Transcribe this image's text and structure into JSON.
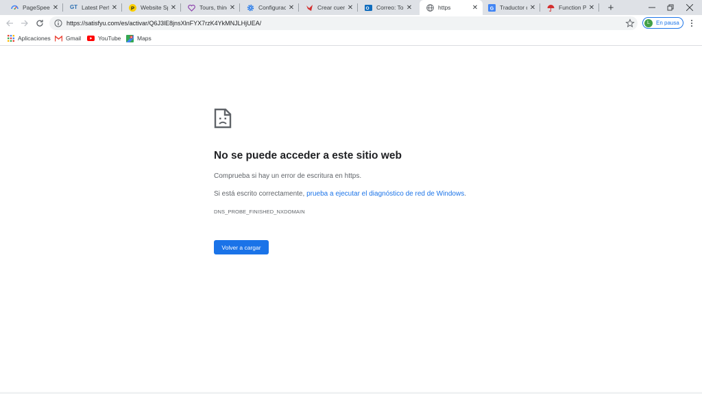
{
  "tabs": [
    {
      "title": "PageSpeed I",
      "icon": "pagespeed-icon"
    },
    {
      "title": "Latest Perfor",
      "icon": "gtmetrix-icon"
    },
    {
      "title": "Website Spe",
      "icon": "pingdom-icon"
    },
    {
      "title": "Tours, things",
      "icon": "heart-icon"
    },
    {
      "title": "Configuració",
      "icon": "gear-icon"
    },
    {
      "title": "Crear cuenta",
      "icon": "crear-cuenta-icon"
    },
    {
      "title": "Correo: Tous",
      "icon": "outlook-icon"
    },
    {
      "title": "https",
      "icon": "globe-icon",
      "active": true
    },
    {
      "title": "Traductor de",
      "icon": "translate-icon"
    },
    {
      "title": "Function Pa",
      "icon": "umbrella-icon"
    }
  ],
  "toolbar": {
    "url": "https://satisfyu.com/es/activar/Q6J3lE8jnsXlnFYX7rzK4YkMNJLHjUEA/",
    "profile_initial": "L",
    "profile_label": "En pausa"
  },
  "bookmarks": [
    {
      "label": "Aplicaciones",
      "icon": "apps-grid-icon"
    },
    {
      "label": "Gmail",
      "icon": "gmail-icon"
    },
    {
      "label": "YouTube",
      "icon": "youtube-icon"
    },
    {
      "label": "Maps",
      "icon": "maps-icon"
    }
  ],
  "error": {
    "title": "No se puede acceder a este sitio web",
    "check_text": "Comprueba si hay un error de escritura en https.",
    "diag_prefix": "Si está escrito correctamente, ",
    "diag_link": "prueba a ejecutar el diagnóstico de red de Windows",
    "diag_suffix": ".",
    "code": "DNS_PROBE_FINISHED_NXDOMAIN",
    "reload_label": "Volver a cargar"
  },
  "colors": {
    "accent": "#1a73e8",
    "tabstrip": "#dee1e6",
    "text_primary": "#202124",
    "text_secondary": "#5f6368"
  }
}
